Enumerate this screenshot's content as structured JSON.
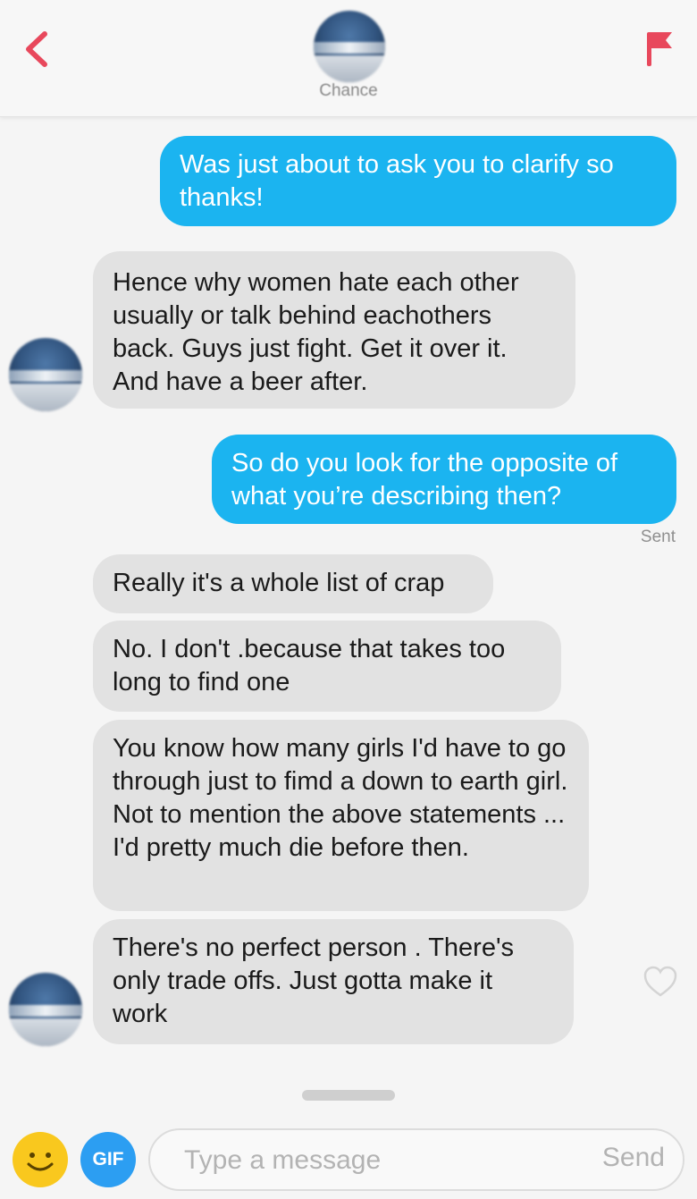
{
  "header": {
    "contact_name": "Chance",
    "back_icon": "chevron-left-icon",
    "flag_icon": "flag-icon",
    "accent_color": "#e8485c"
  },
  "messages": [
    {
      "sender": "me",
      "text": "Was just about to ask you to clarify so thanks!"
    },
    {
      "sender": "them",
      "text": "Hence why women hate each other usually or talk behind eachothers back. Guys just fight. Get it over it. And have a beer after."
    },
    {
      "sender": "me",
      "text": "So do you look for the opposite of what you’re describing then?",
      "status": "Sent"
    },
    {
      "sender": "them",
      "text": "Really it's a whole list of crap"
    },
    {
      "sender": "them",
      "text": "No. I don't .because that takes too long to find one"
    },
    {
      "sender": "them",
      "text": "You know how many girls I'd have to go through just to fimd a down to earth girl. Not to mention the above statements ... I'd pretty much die before then."
    },
    {
      "sender": "them",
      "text": "There's no perfect person . There's only trade offs. Just gotta make it work"
    }
  ],
  "composer": {
    "emoji_icon": "smiley-icon",
    "gif_label": "GIF",
    "placeholder": "Type a message",
    "send_label": "Send"
  },
  "colors": {
    "sent_bubble": "#1bb4f0",
    "received_bubble": "#e2e2e2",
    "background": "#f5f5f5"
  }
}
